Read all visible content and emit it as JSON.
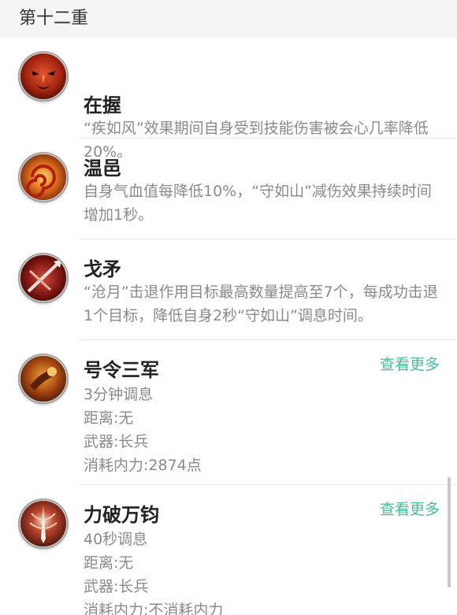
{
  "section": {
    "title": "第十二重"
  },
  "skills": [
    {
      "name": "在握",
      "icon": "red-warrior-face-icon",
      "desc": "“疾如风”效果期间自身受到技能伤害被会心几率降低20%。"
    },
    {
      "name": "温邑",
      "icon": "flame-spiral-icon",
      "desc": "自身气血值每降低10%，“守如山”减伤效果持续时间增加1秒。"
    },
    {
      "name": "戈矛",
      "icon": "crossed-spear-icon",
      "desc": "“沧月”击退作用目标最高数量提高至7个，每成功击退1个目标，降低自身2秒“守如山”调息时间。"
    },
    {
      "name": "号令三军",
      "icon": "war-horn-icon",
      "more": "查看更多",
      "lines": [
        "3分钟调息",
        "距离:无",
        "武器:长兵",
        "消耗内力:2874点"
      ]
    },
    {
      "name": "力破万钧",
      "icon": "spear-burst-icon",
      "more": "查看更多",
      "lines": [
        "40秒调息",
        "距离:无",
        "武器:长兵",
        "消耗内力:不消耗内力"
      ]
    }
  ],
  "colors": {
    "accent": "#43c097",
    "header_bg": "#f5f5f5",
    "text_primary": "#222222",
    "text_secondary": "#8a8a8a"
  }
}
